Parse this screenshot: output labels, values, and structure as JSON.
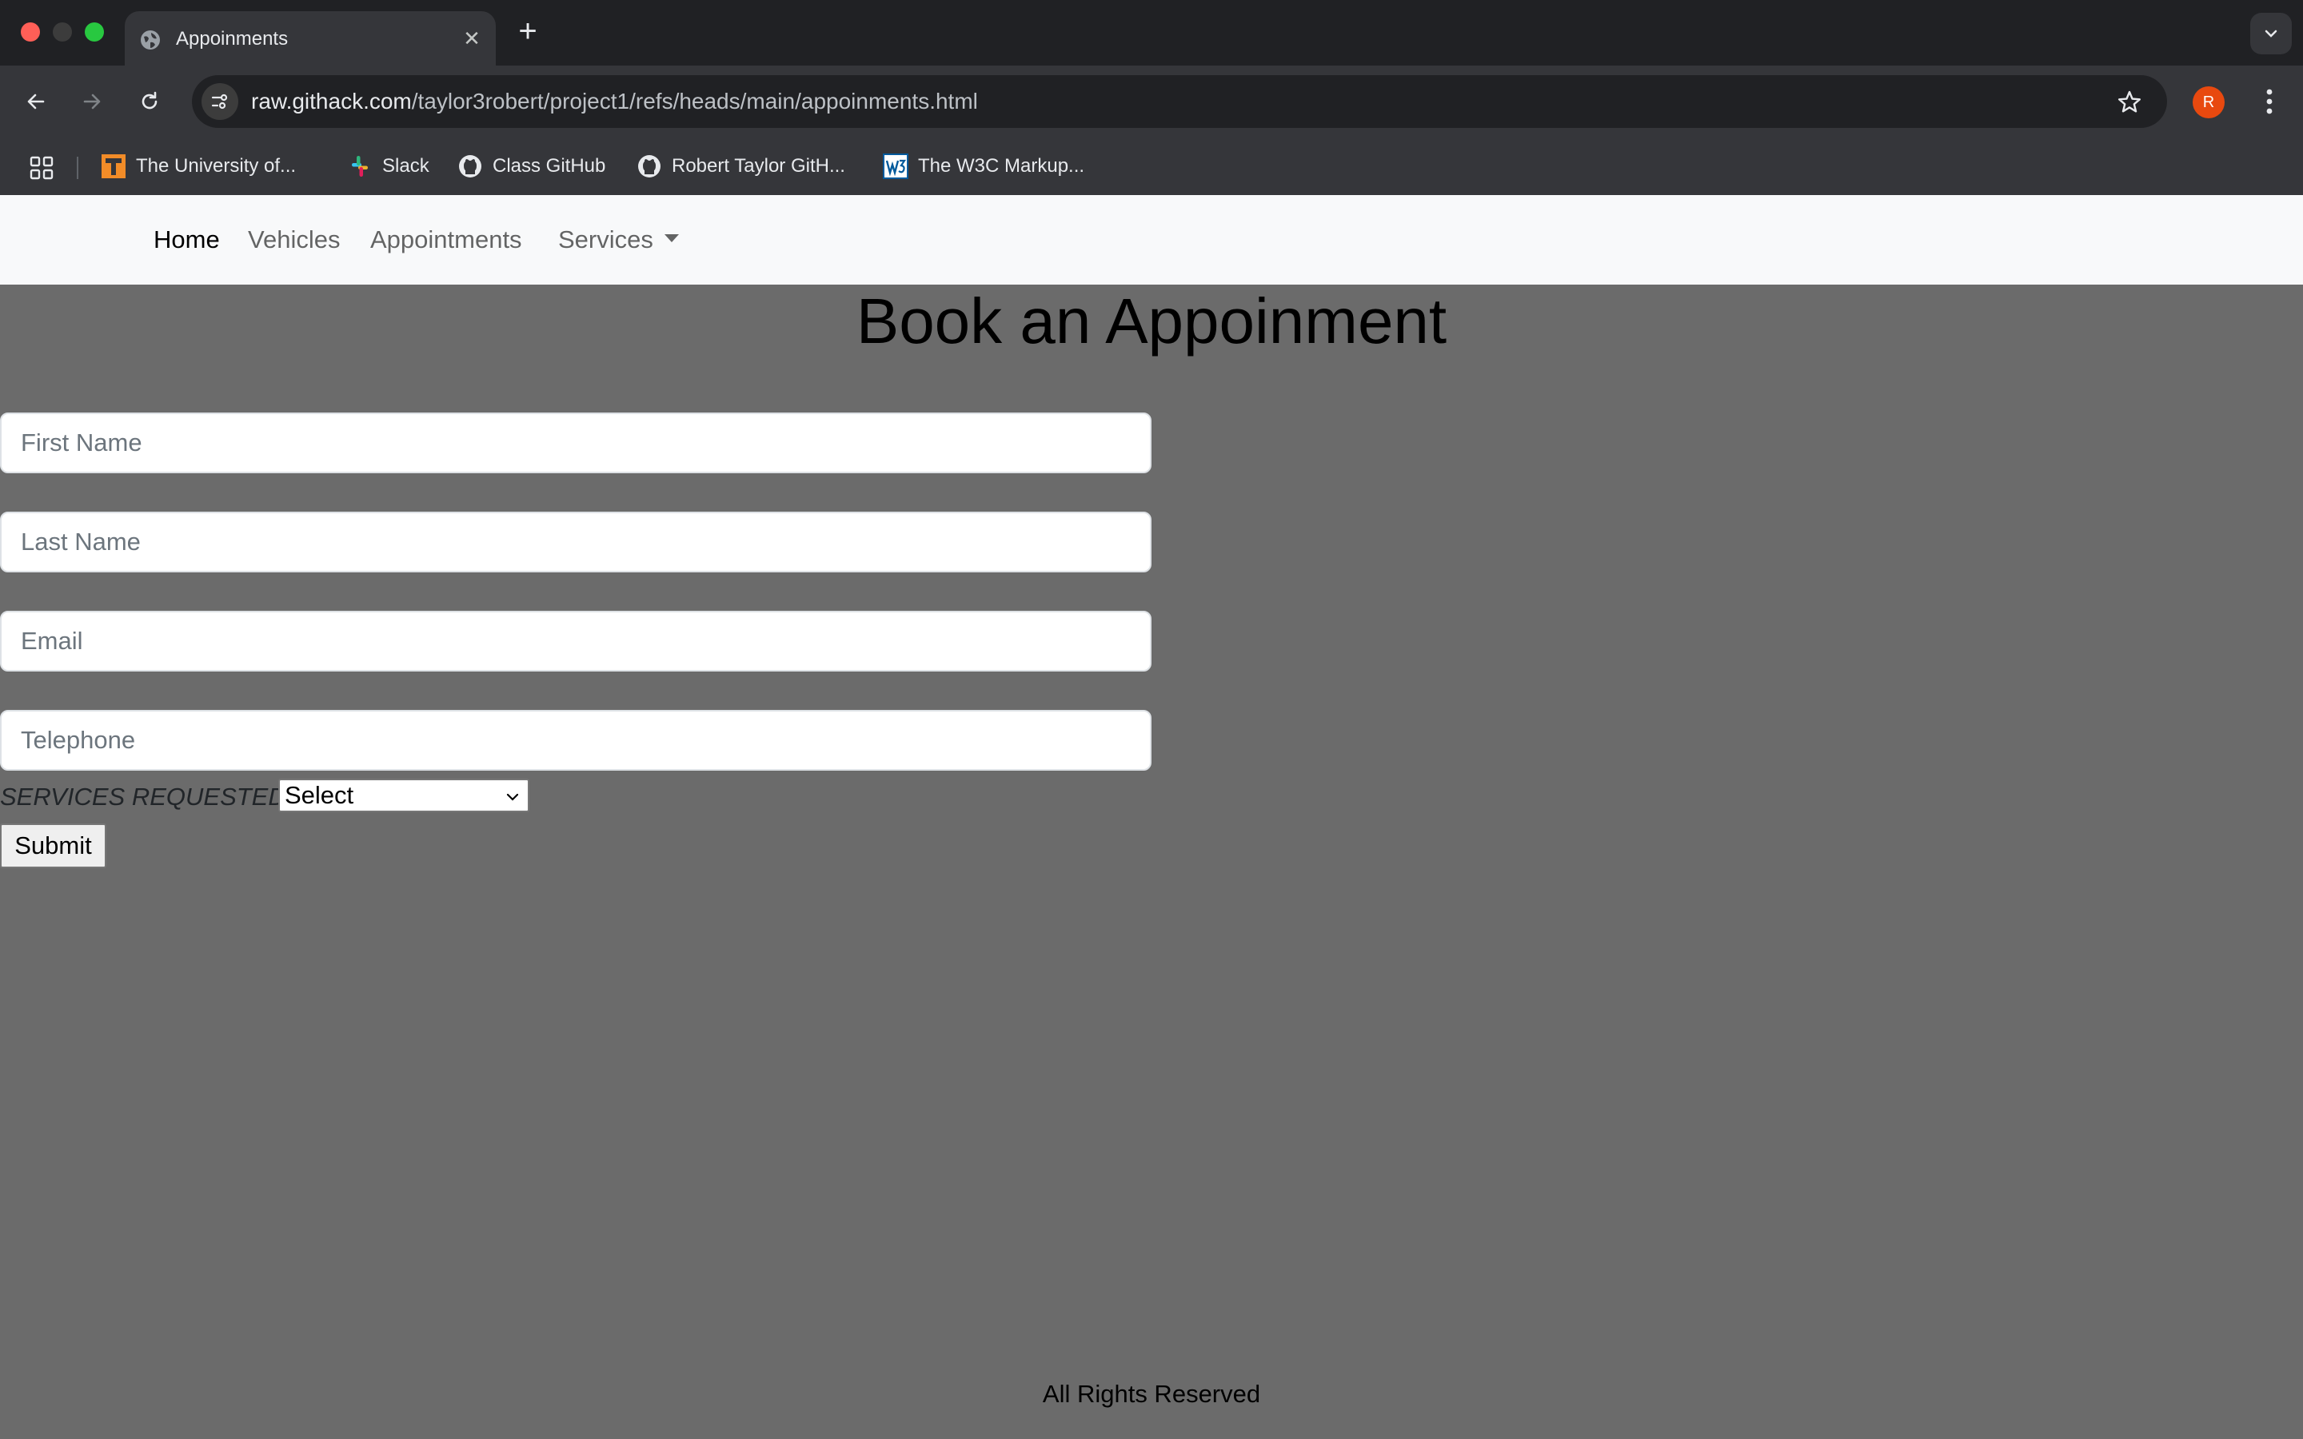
{
  "browser": {
    "tab_title": "Appoinments",
    "url_host": "raw.githack.com",
    "url_path": "/taylor3robert/project1/refs/heads/main/appoinments.html",
    "profile_initial": "R",
    "bookmarks": [
      {
        "label": "The University of...",
        "icon": "ut-logo-icon"
      },
      {
        "label": "Slack",
        "icon": "slack-icon"
      },
      {
        "label": "Class GitHub",
        "icon": "github-icon"
      },
      {
        "label": "Robert Taylor GitH...",
        "icon": "github-icon"
      },
      {
        "label": "The W3C Markup...",
        "icon": "w3c-icon"
      }
    ]
  },
  "navbar": {
    "links": [
      "Home",
      "Vehicles",
      "Appointments",
      "Services"
    ],
    "active": "Home"
  },
  "page": {
    "title": "Book an Appoinment",
    "fields": {
      "first_name_placeholder": "First Name",
      "last_name_placeholder": "Last Name",
      "email_placeholder": "Email",
      "telephone_placeholder": "Telephone"
    },
    "services_label": "SERVICES REQUESTED",
    "services_selected": "Select",
    "submit_label": "Submit",
    "footer": "All Rights Reserved"
  },
  "colors": {
    "page_background": "#6b6b6b",
    "navbar_background": "#f8f9fa",
    "profile_badge": "#e8490f"
  }
}
